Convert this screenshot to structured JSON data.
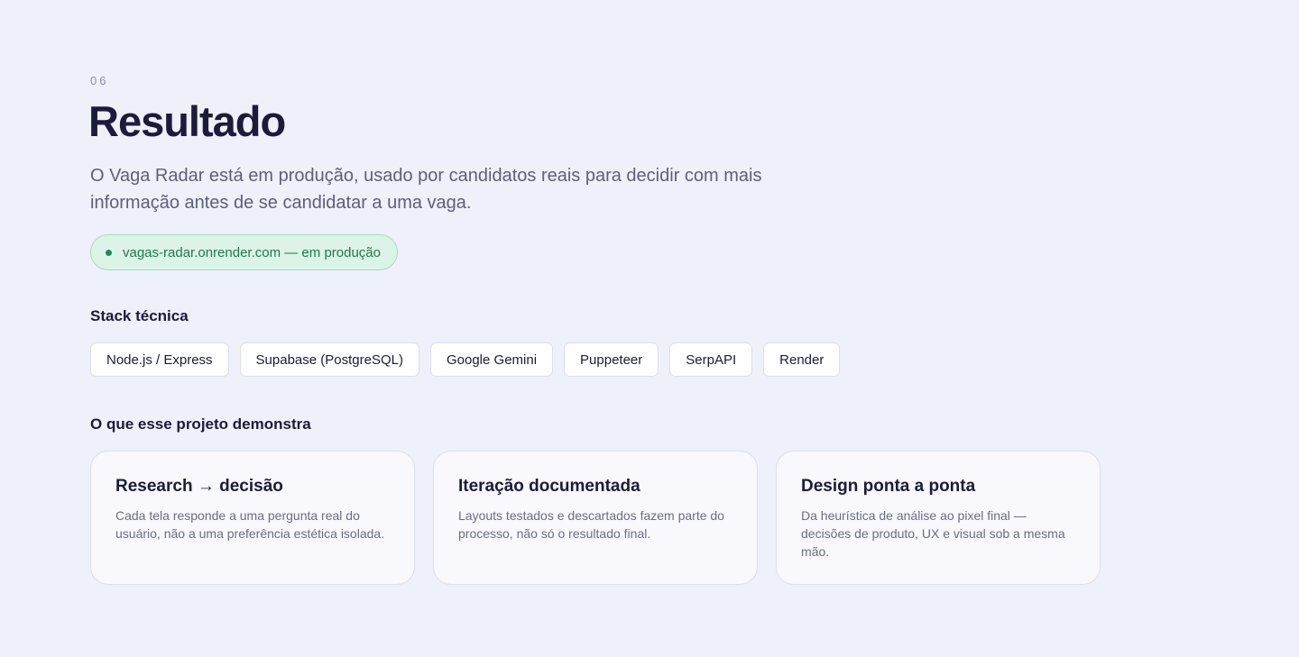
{
  "section": {
    "number": "06",
    "title": "Resultado",
    "lead": "O Vaga Radar está em produção, usado por candidatos reais para decidir com mais informação antes de se candidatar a uma vaga.",
    "status": {
      "text": "vagas-radar.onrender.com — em produção",
      "color": "#1f8a53"
    }
  },
  "stack": {
    "heading": "Stack técnica",
    "items": [
      "Node.js / Express",
      "Supabase (PostgreSQL)",
      "Google Gemini",
      "Puppeteer",
      "SerpAPI",
      "Render"
    ]
  },
  "demo": {
    "heading": "O que esse projeto demonstra",
    "cards": [
      {
        "title": "Research → decisão",
        "text": "Cada tela responde a uma pergunta real do usuário, não a uma preferência estética isolada."
      },
      {
        "title": "Iteração documentada",
        "text": "Layouts testados e descartados fazem parte do processo, não só o resultado final."
      },
      {
        "title": "Design ponta a ponta",
        "text": "Da heurística de análise ao pixel final — decisões de produto, UX e visual sob a mesma mão."
      }
    ]
  }
}
